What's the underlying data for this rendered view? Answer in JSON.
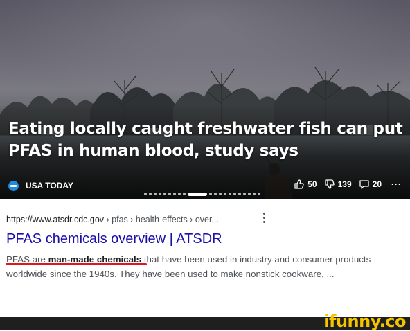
{
  "news_card": {
    "headline_line1": "Eating locally caught freshwater fish can put",
    "headline_line2": "PFAS in human blood, study says",
    "source": "USA TODAY",
    "source_logo_color": "#1e8ce0",
    "likes": "50",
    "dislikes": "139",
    "comments": "20",
    "more": "···",
    "carousel_dots_before": 9,
    "carousel_dots_after": 11
  },
  "result": {
    "url_base": "https://www.atsdr.cdc.gov",
    "url_path": " › pfas › health-effects › over...",
    "title": "PFAS chemicals overview | ATSDR",
    "snippet_part1": "PFAS are ",
    "snippet_bold": "man-made chemicals",
    "snippet_part2": " that have been used in industry and consumer products worldwide since the 1940s. They have been used to make nonstick cookware, ...",
    "title_color": "#1a0dab",
    "highlight_color": "#e0161e"
  },
  "watermark": "ifunny.co"
}
